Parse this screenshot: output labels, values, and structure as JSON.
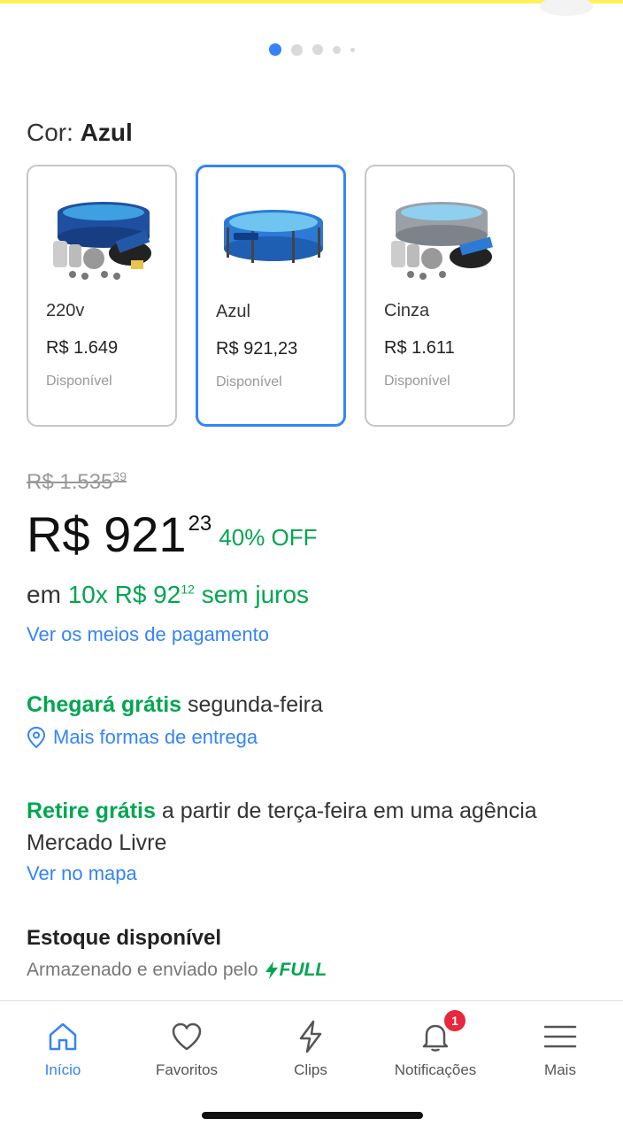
{
  "carousel": {
    "count": 5,
    "active_index": 0
  },
  "color_selector": {
    "label": "Cor:",
    "selected": "Azul",
    "options": [
      {
        "name": "220v",
        "price": "R$ 1.649",
        "status": "Disponível",
        "selected": false
      },
      {
        "name": "Azul",
        "price": "R$ 921,23",
        "status": "Disponível",
        "selected": true
      },
      {
        "name": "Cinza",
        "price": "R$ 1.611",
        "status": "Disponível",
        "selected": false
      }
    ]
  },
  "pricing": {
    "old_price": "R$ 1.535",
    "old_price_cents": "39",
    "price": "R$ 921",
    "price_cents": "23",
    "discount": "40% OFF",
    "installments_prefix": "em",
    "installments_value": "10x R$ 92",
    "installments_cents": "12",
    "installments_suffix": "sem juros",
    "payment_link": "Ver os meios de pagamento"
  },
  "shipping": {
    "highlight": "Chegará grátis",
    "day": "segunda-feira",
    "more_link": "Mais formas de entrega"
  },
  "pickup": {
    "highlight": "Retire grátis",
    "text": "a partir de terça-feira em uma agência Mercado Livre",
    "map_link": "Ver no mapa"
  },
  "stock": {
    "title": "Estoque disponível",
    "subtitle": "Armazenado e enviado pelo",
    "full_label": "FULL"
  },
  "tabbar": {
    "items": [
      {
        "label": "Início",
        "icon": "home-icon",
        "active": true
      },
      {
        "label": "Favoritos",
        "icon": "heart-icon"
      },
      {
        "label": "Clips",
        "icon": "lightning-icon"
      },
      {
        "label": "Notificações",
        "icon": "bell-icon",
        "badge": "1"
      },
      {
        "label": "Mais",
        "icon": "menu-icon"
      }
    ]
  },
  "colors": {
    "accent": "#3483fa",
    "green": "#00a650",
    "badge": "#e8263c",
    "brand_yellow": "#fff159"
  }
}
